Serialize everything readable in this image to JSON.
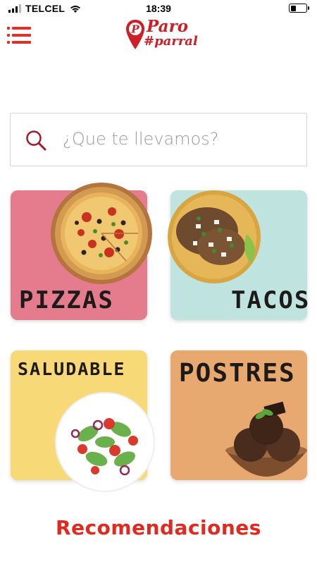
{
  "status_bar": {
    "carrier": "TELCEL",
    "time": "18:39"
  },
  "header": {
    "menu_icon": "menu-icon",
    "logo": {
      "title": "Paro",
      "subtitle": "#parral",
      "pin_letter": "P"
    }
  },
  "search": {
    "placeholder": "¿Que te llevamos?",
    "icon": "search-icon"
  },
  "categories": [
    {
      "label": "PIZZAS",
      "color": "#e57c8e"
    },
    {
      "label": "TACOS",
      "color": "#bfe3df"
    },
    {
      "label": "SALUDABLE",
      "color": "#f7d978"
    },
    {
      "label": "POSTRES",
      "color": "#e7a96f"
    }
  ],
  "section_title": "Recomendaciones",
  "colors": {
    "brand": "#cc1f26",
    "accent": "#e0302a"
  }
}
